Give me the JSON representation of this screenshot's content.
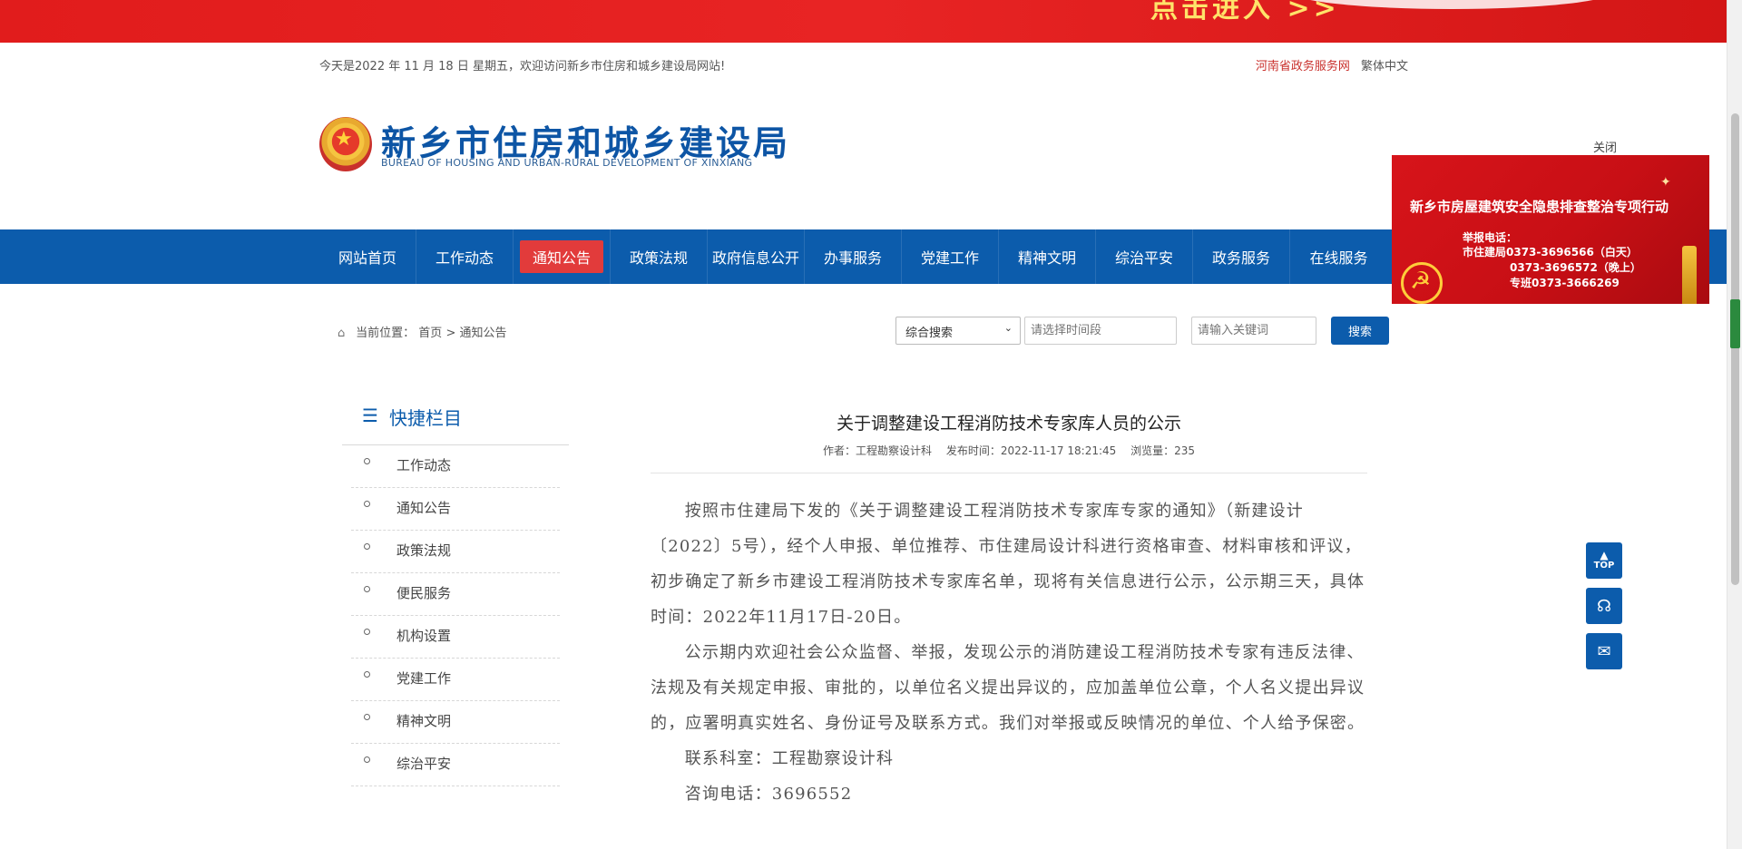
{
  "banner": {
    "slogan": "点击进入 >>"
  },
  "infobar": {
    "date_text": "今天是2022 年 11 月 18 日 星期五，欢迎访问新乡市住房和城乡建设局网站!",
    "gov_link": "河南省政务服务网",
    "lang_link": "繁体中文"
  },
  "logo": {
    "cn": "新乡市住房和城乡建设局",
    "en": "BUREAU  OF HOUSING AND URBAN-RURAL DEVELOPMENT OF XINXIANG"
  },
  "nav": {
    "items": [
      {
        "label": "网站首页"
      },
      {
        "label": "工作动态"
      },
      {
        "label": "通知公告"
      },
      {
        "label": "政策法规"
      },
      {
        "label": "政府信息公开"
      },
      {
        "label": "办事服务"
      },
      {
        "label": "党建工作"
      },
      {
        "label": "精神文明"
      },
      {
        "label": "综治平安"
      },
      {
        "label": "政务服务"
      },
      {
        "label": "在线服务"
      }
    ],
    "active": "通知公告"
  },
  "float_ad": {
    "close_label": "关闭",
    "title": "新乡市房屋建筑安全隐患排查整治专项行动",
    "line1": "举报电话：",
    "line2": "市住建局0373-3696566（白天）",
    "line3": "0373-3696572（晚上）",
    "line4": "专班0373-3666269"
  },
  "breadcrumb": {
    "prefix": "当前位置：",
    "home": "首页",
    "sep": " > ",
    "current": "通知公告"
  },
  "search": {
    "select_value": "综合搜索",
    "time_placeholder": "请选择时间段",
    "keyword_placeholder": "请输入关键词",
    "button_label": "搜索"
  },
  "sidebar": {
    "title": "快捷栏目",
    "items": [
      {
        "label": "工作动态"
      },
      {
        "label": "通知公告"
      },
      {
        "label": "政策法规"
      },
      {
        "label": "便民服务"
      },
      {
        "label": "机构设置"
      },
      {
        "label": "党建工作"
      },
      {
        "label": "精神文明"
      },
      {
        "label": "综治平安"
      }
    ]
  },
  "article": {
    "title": "关于调整建设工程消防技术专家库人员的公示",
    "author": "作者：工程勘察设计科",
    "published": "发布时间：2022-11-17 18:21:45",
    "views": "浏览量：235",
    "paragraphs": [
      "按照市住建局下发的《关于调整建设工程消防技术专家库专家的通知》（新建设计〔2022〕5号），经个人申报、单位推荐、市住建局设计科进行资格审查、材料审核和评议，初步确定了新乡市建设工程消防技术专家库名单，现将有关信息进行公示，公示期三天，具体时间：2022年11月17日-20日。",
      "公示期内欢迎社会公众监督、举报，发现公示的消防建设工程消防技术专家有违反法律、法规及有关规定申报、审批的，以单位名义提出异议的，应加盖单位公章，个人名义提出异议的，应署明真实姓名、身份证号及联系方式。我们对举报或反映情况的单位、个人给予保密。",
      "联系科室：工程勘察设计科",
      "咨询电话：3696552"
    ]
  },
  "float_buttons": {
    "top_label": "TOP"
  },
  "colors": {
    "brand_blue": "#0c5cac",
    "active_red": "#e23b3b",
    "banner_red": "#e11c1c"
  }
}
